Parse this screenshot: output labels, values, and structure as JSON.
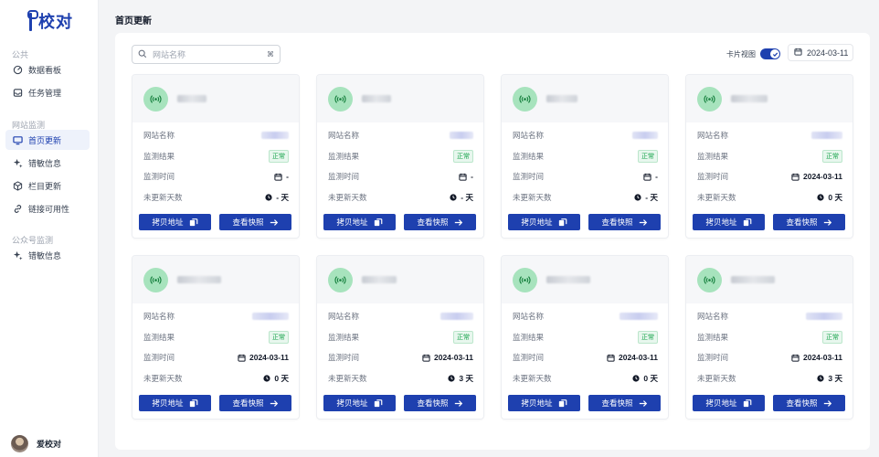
{
  "brand": {
    "name": "校对"
  },
  "sidebar": {
    "sections": [
      {
        "title": "公共",
        "items": [
          {
            "label": "数据看板",
            "icon": "dashboard-icon"
          },
          {
            "label": "任务管理",
            "icon": "inbox-icon"
          }
        ]
      },
      {
        "title": "网站监测",
        "items": [
          {
            "label": "首页更新",
            "icon": "monitor-icon",
            "active": true
          },
          {
            "label": "错敏信息",
            "icon": "sparkle-icon"
          },
          {
            "label": "栏目更新",
            "icon": "box-icon"
          },
          {
            "label": "链接可用性",
            "icon": "link-icon"
          }
        ]
      },
      {
        "title": "公众号监测",
        "items": [
          {
            "label": "错敏信息",
            "icon": "sparkle-icon"
          }
        ]
      }
    ],
    "user": {
      "name": "爱校对"
    }
  },
  "page": {
    "title": "首页更新"
  },
  "toolbar": {
    "search_placeholder": "网站名称",
    "shortcut": "⌘",
    "card_view_label": "卡片视图",
    "card_view_on": true,
    "date": "2024-03-11"
  },
  "labels": {
    "site_name": "网站名称",
    "result": "监测结果",
    "time": "监测时间",
    "days": "未更新天数",
    "copy": "拷贝地址",
    "snapshot": "查看快照",
    "status_ok": "正常",
    "day_unit": "天"
  },
  "colors": {
    "primary": "#1e40af",
    "success": "#16a34a",
    "signal_bg": "#a7e3bd"
  },
  "cards": [
    {
      "status": "正常",
      "time": "-",
      "days": "-"
    },
    {
      "status": "正常",
      "time": "-",
      "days": "-"
    },
    {
      "status": "正常",
      "time": "-",
      "days": "-"
    },
    {
      "status": "正常",
      "time": "2024-03-11",
      "days": "0"
    },
    {
      "status": "正常",
      "time": "2024-03-11",
      "days": "0"
    },
    {
      "status": "正常",
      "time": "2024-03-11",
      "days": "3"
    },
    {
      "status": "正常",
      "time": "2024-03-11",
      "days": "0"
    },
    {
      "status": "正常",
      "time": "2024-03-11",
      "days": "3"
    }
  ]
}
